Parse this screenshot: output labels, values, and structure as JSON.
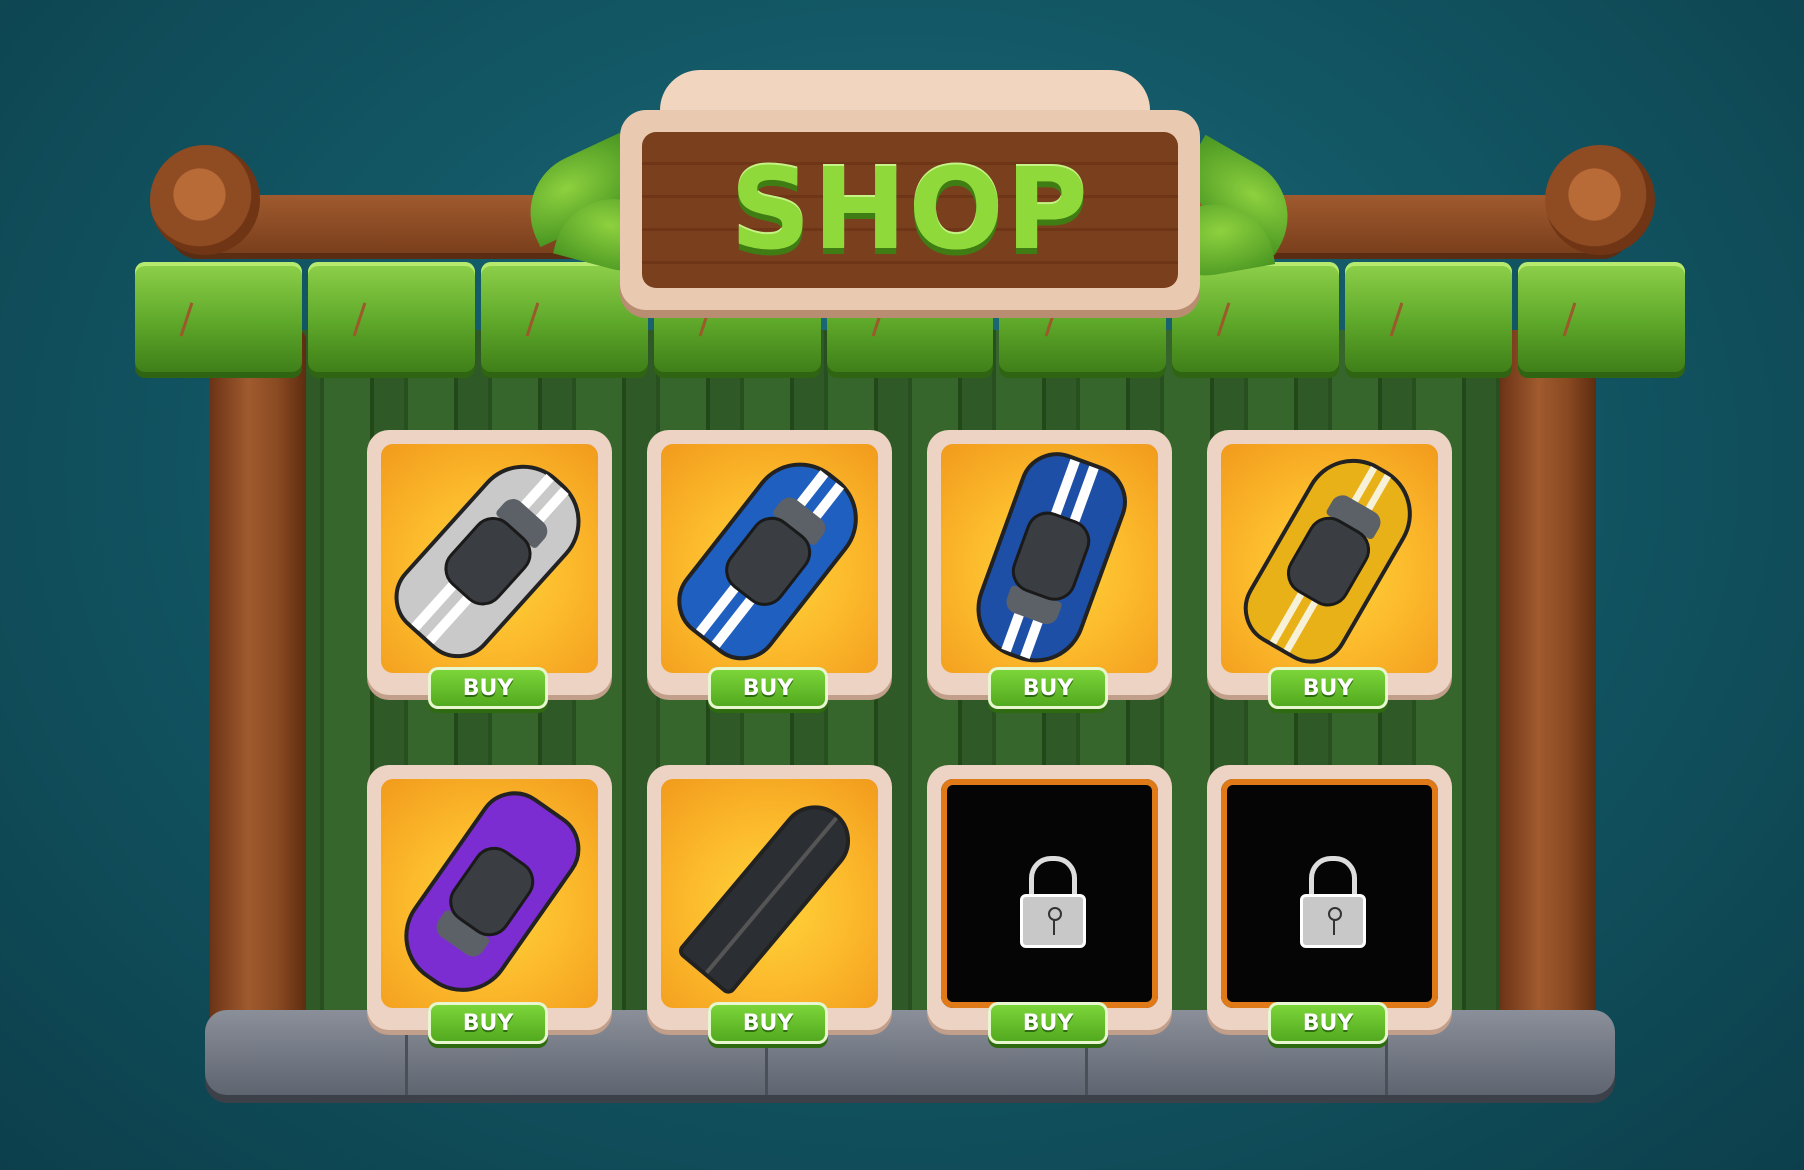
{
  "sign": {
    "title": "SHOP"
  },
  "items": [
    {
      "id": "car-1",
      "type": "car",
      "color": "#c9c9c9",
      "stripe": "#ffffff",
      "locked": false,
      "button": "BUY"
    },
    {
      "id": "car-2",
      "type": "car",
      "color": "#1f5fbf",
      "stripe": "#ffffff",
      "locked": false,
      "button": "BUY"
    },
    {
      "id": "car-3",
      "type": "car",
      "color": "#1e4fa6",
      "stripe": "#ffffff",
      "locked": false,
      "button": "BUY"
    },
    {
      "id": "car-4",
      "type": "car",
      "color": "#e8b117",
      "stripe": "#f7f1d8",
      "locked": false,
      "button": "BUY"
    },
    {
      "id": "car-5",
      "type": "car",
      "color": "#7b2dd1",
      "stripe": "#b684ff",
      "locked": false,
      "button": "BUY"
    },
    {
      "id": "car-6",
      "type": "car",
      "color": "#2b2e33",
      "stripe": "#444",
      "locked": false,
      "button": "BUY"
    },
    {
      "id": "car-7",
      "type": "locked",
      "icon": "lock-icon",
      "locked": true,
      "button": "BUY"
    },
    {
      "id": "car-8",
      "type": "locked",
      "icon": "lock-icon",
      "locked": true,
      "button": "BUY"
    }
  ],
  "colors": {
    "background": "#135866",
    "roof_green": "#5ea82a",
    "wood": "#8f4b22",
    "card_orange": "#fbb62a"
  }
}
